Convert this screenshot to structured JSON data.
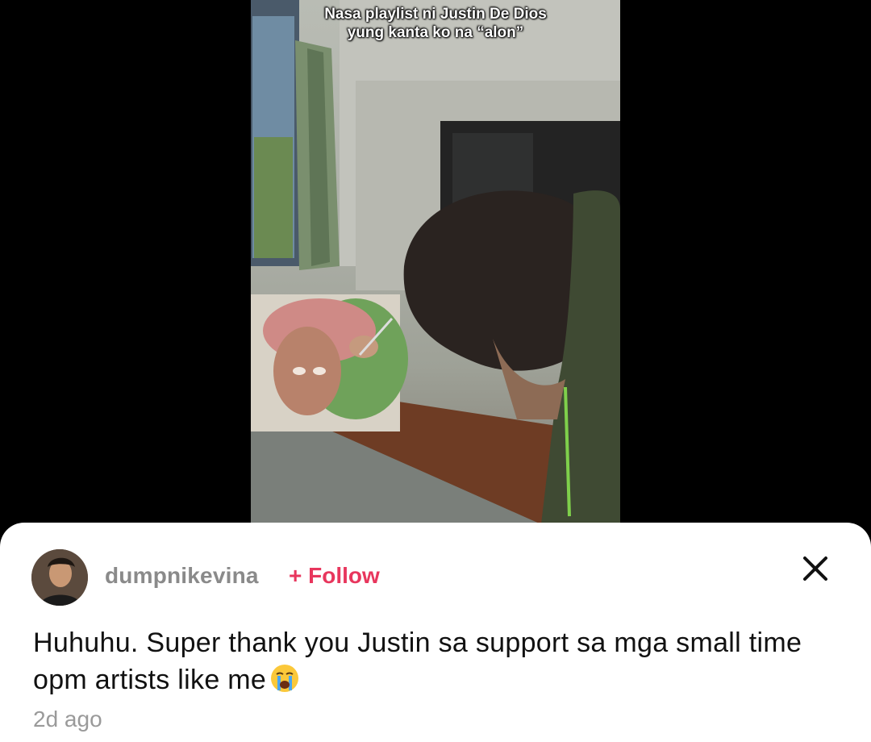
{
  "video": {
    "caption_line1": "Nasa playlist ni Justin De Dios",
    "caption_line2": "yung kanta ko na “alon”"
  },
  "comment": {
    "username": "dumpnikevina",
    "follow_label": "+ Follow",
    "text": "Huhuhu. Super thank you Justin sa support sa mga small time opm artists like me",
    "emoji": "crying-face-emoji",
    "timestamp": "2d ago"
  },
  "colors": {
    "follow": "#e8365d",
    "username": "#8a8a8a",
    "timestamp": "#9a9a9a",
    "background": "#000000",
    "sheet": "#ffffff"
  }
}
